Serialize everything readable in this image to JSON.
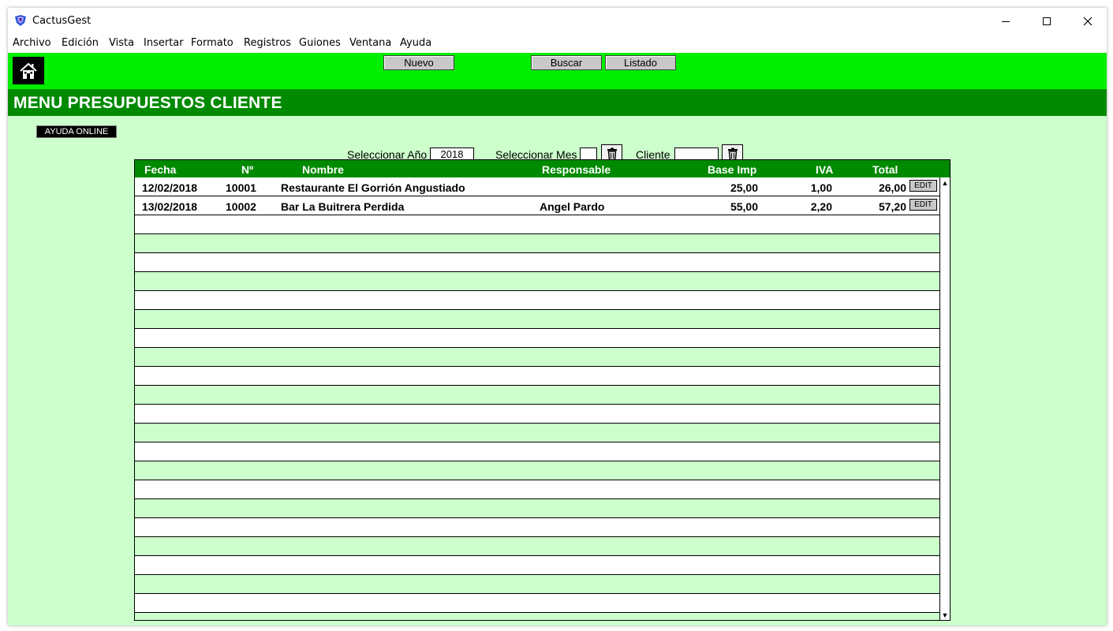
{
  "window": {
    "title": "CactusGest",
    "minimize_glyph": "—",
    "maximize_glyph": "☐",
    "close_glyph": "✕"
  },
  "menu": [
    "Archivo",
    "Edición",
    "Vista",
    "Insertar",
    "Formato",
    "Registros",
    "Guiones",
    "Ventana",
    "Ayuda"
  ],
  "toolbar": {
    "new_label": "Nuevo",
    "search_label": "Buscar",
    "list_label": "Listado",
    "home_icon": "home-icon"
  },
  "page": {
    "title": "MENU PRESUPUESTOS CLIENTE",
    "help_label": "AYUDA ONLINE"
  },
  "filters": {
    "year_label": "Seleccionar Año",
    "year_value": "2018",
    "month_label": "Seleccionar Mes",
    "month_value": "",
    "client_label": "Cliente",
    "client_value": ""
  },
  "table": {
    "headers": {
      "fecha": "Fecha",
      "numero": "Nº",
      "nombre": "Nombre",
      "responsable": "Responsable",
      "base": "Base Imp",
      "iva": "IVA",
      "total": "Total"
    },
    "edit_label": "EDIT",
    "rows": [
      {
        "fecha": "12/02/2018",
        "numero": "10001",
        "nombre": "Restaurante El  Gorrión Angustiado",
        "responsable": "",
        "base": "25,00",
        "iva": "1,00",
        "total": "26,00"
      },
      {
        "fecha": "13/02/2018",
        "numero": "10002",
        "nombre": "Bar La Buitrera Perdida",
        "responsable": "Angel Pardo",
        "base": "55,00",
        "iva": "2,20",
        "total": "57,20"
      }
    ]
  },
  "colors": {
    "toolbar_green": "#00ee00",
    "header_green": "#008a00",
    "content_bg": "#ccffcc"
  }
}
